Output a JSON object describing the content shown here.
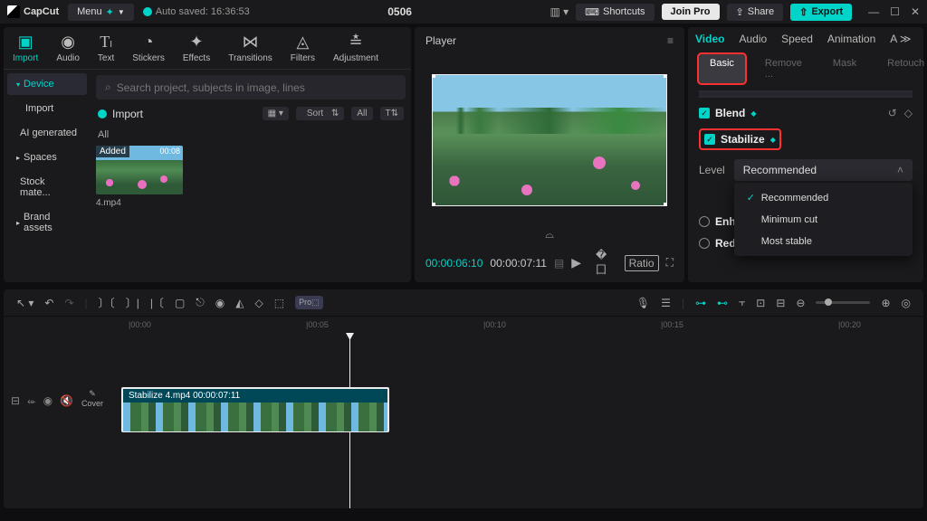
{
  "titlebar": {
    "brand": "CapCut",
    "menu": "Menu",
    "autosave": "Auto saved: 16:36:53",
    "project": "0506",
    "shortcuts": "Shortcuts",
    "join_pro": "Join Pro",
    "share": "Share",
    "export": "Export"
  },
  "media_tabs": {
    "import": "Import",
    "audio": "Audio",
    "text": "Text",
    "stickers": "Stickers",
    "effects": "Effects",
    "transitions": "Transitions",
    "filters": "Filters",
    "adjustment": "Adjustment"
  },
  "sidebar": {
    "device": "Device",
    "import": "Import",
    "ai": "AI generated",
    "spaces": "Spaces",
    "stock": "Stock mate...",
    "brand": "Brand assets"
  },
  "media_main": {
    "search_placeholder": "Search project, subjects in image, lines",
    "import_header": "Import",
    "sort": "Sort",
    "all_btn": "All",
    "filter_all": "All",
    "thumb_badge": "Added",
    "thumb_time": "00:08",
    "thumb_name": "4.mp4"
  },
  "player": {
    "title": "Player",
    "tc_current": "00:00:06:10",
    "tc_total": "00:00:07:11",
    "ratio": "Ratio"
  },
  "props_tabs": {
    "video": "Video",
    "audio": "Audio",
    "speed": "Speed",
    "animation": "Animation",
    "ai_more": "A"
  },
  "props_sub": {
    "basic": "Basic",
    "remove": "Remove ...",
    "mask": "Mask",
    "retouch": "Retouch"
  },
  "props": {
    "blend": "Blend",
    "stabilize": "Stabilize",
    "level": "Level",
    "level_value": "Recommended",
    "dd_recommended": "Recommended",
    "dd_min": "Minimum cut",
    "dd_most": "Most stable",
    "enhance": "Enhance",
    "reduce": "Reduce i…"
  },
  "timeline": {
    "cover": "Cover",
    "clip_label": "Stabilize  4.mp4  00:00:07:11",
    "ticks": [
      "|00:00",
      "|00:05",
      "|00:10",
      "|00:15",
      "|00:20"
    ]
  }
}
